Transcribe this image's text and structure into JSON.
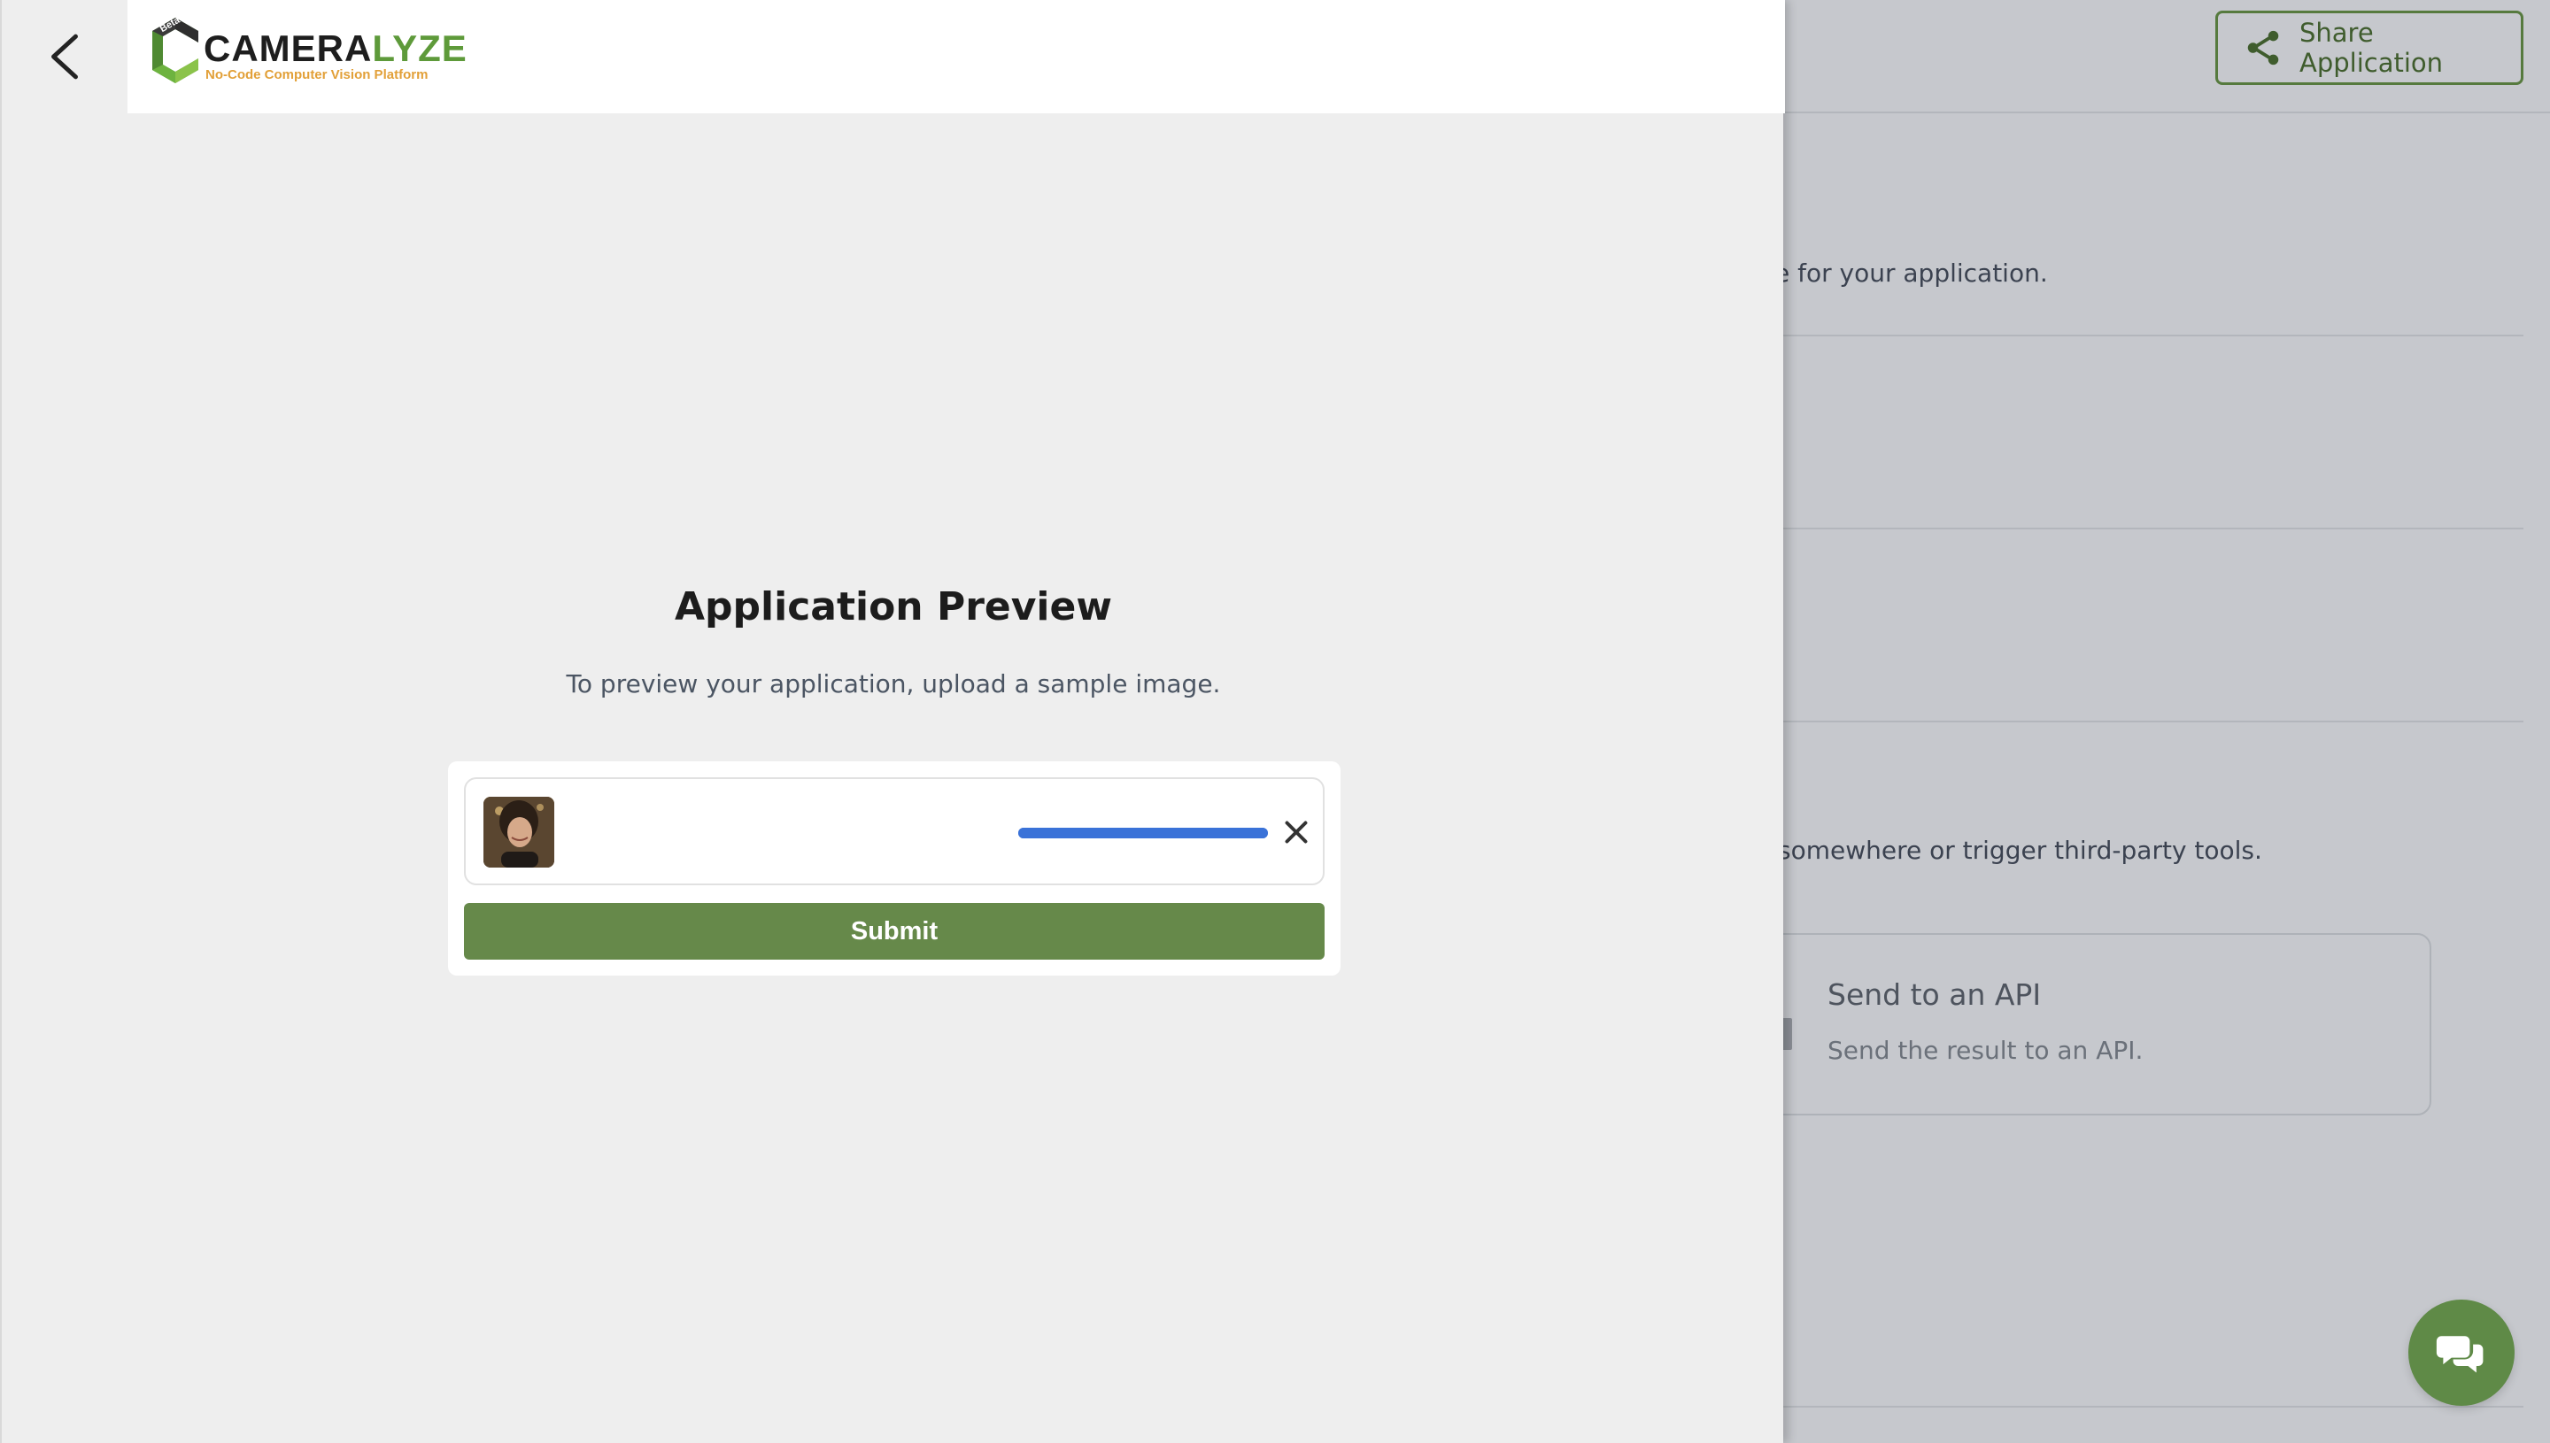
{
  "background_page": {
    "share_button_label": "Share Application",
    "text_1": "e for your application.",
    "text_2": "somewhere or trigger third-party tools.",
    "api_card": {
      "title": "Send to an API",
      "description": "Send the result to an API."
    }
  },
  "panel": {
    "logo": {
      "wordmark_dark": "CAMERA",
      "wordmark_green": "LYZE",
      "tagline": "No-Code Computer Vision Platform",
      "badge": "Beta"
    },
    "title": "Application Preview",
    "subtitle": "To preview your application, upload a sample image.",
    "upload": {
      "progress_percent": 100
    },
    "submit_label": "Submit"
  },
  "colors": {
    "brand_green": "#66894a",
    "progress_blue": "#3a72d8",
    "logo_orange": "#e2a038"
  },
  "icons": {
    "back": "chevron-left-icon",
    "share": "share-icon",
    "remove": "close-icon",
    "chat": "chat-bubbles-icon"
  }
}
